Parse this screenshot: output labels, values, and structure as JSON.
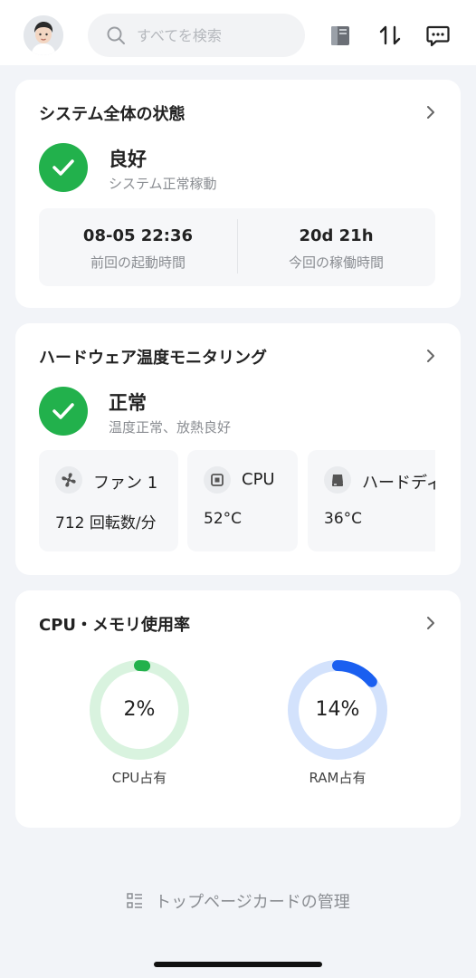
{
  "header": {
    "search_placeholder": "すべてを検索",
    "icons": [
      "avatar",
      "search-icon",
      "nas-device-icon",
      "transfer-icon",
      "message-icon"
    ]
  },
  "system_status": {
    "title": "システム全体の状態",
    "status": "良好",
    "detail": "システム正常稼動",
    "stats": [
      {
        "value": "08-05 22:36",
        "label": "前回の起動時間"
      },
      {
        "value": "20d 21h",
        "label": "今回の稼働時間"
      }
    ]
  },
  "hardware": {
    "title": "ハードウェア温度モニタリング",
    "status": "正常",
    "detail": "温度正常、放熱良好",
    "items": [
      {
        "name": "ファン 1",
        "value": "712 回転数/分",
        "icon": "fan-icon"
      },
      {
        "name": "CPU",
        "value": "52°C",
        "icon": "cpu-icon"
      },
      {
        "name": "ハードディ",
        "value": "36°C",
        "icon": "disk-icon"
      }
    ]
  },
  "usage": {
    "title": "CPU・メモリ使用率",
    "cpu": {
      "percent_text": "2%",
      "percent": 2,
      "label": "CPU占有",
      "color": "#22b14c",
      "track": "#d9f3df"
    },
    "ram": {
      "percent_text": "14%",
      "percent": 14,
      "label": "RAM占有",
      "color": "#1a5ff0",
      "track": "#d3e2fc"
    }
  },
  "footer": {
    "manage_label": "トップページカードの管理"
  },
  "colors": {
    "success": "#22b14c",
    "accent": "#1a5ff0"
  }
}
